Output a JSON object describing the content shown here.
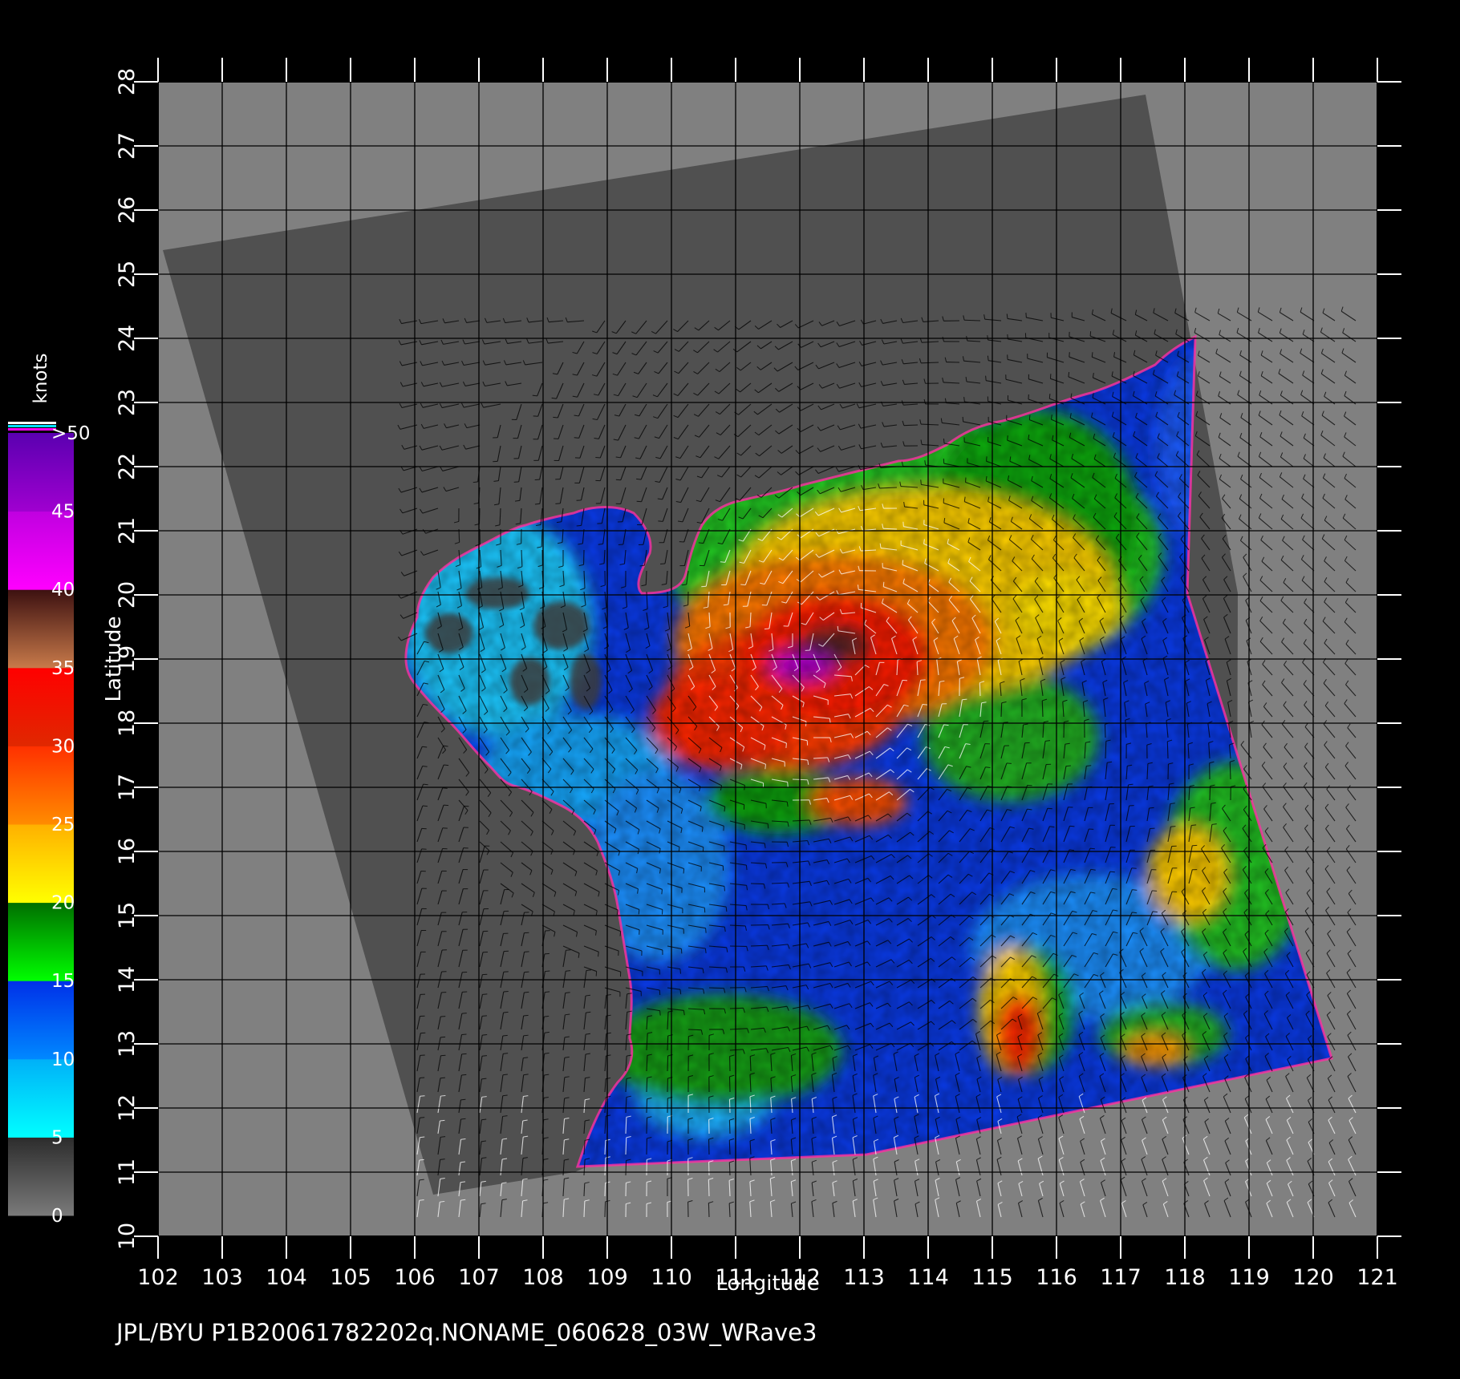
{
  "map": {
    "lon_range": [
      102,
      121
    ],
    "lat_range": [
      10,
      28
    ],
    "lon_ticks": [
      "102",
      "103",
      "104",
      "105",
      "106",
      "107",
      "108",
      "109",
      "110",
      "111",
      "112",
      "113",
      "114",
      "115",
      "116",
      "117",
      "118",
      "119",
      "120",
      "121"
    ],
    "lat_ticks": [
      "10",
      "11",
      "12",
      "13",
      "14",
      "15",
      "16",
      "17",
      "18",
      "19",
      "20",
      "21",
      "22",
      "23",
      "24",
      "25",
      "26",
      "27",
      "28"
    ],
    "xlabel": "Longitude",
    "ylabel": "Latitude",
    "grid": true,
    "storm_center": {
      "lon": 112.7,
      "lat": 19.1
    },
    "colors": {
      "background": "#000000",
      "land_and_offswath": "#808080",
      "swath_no_data": "#505050",
      "grid": "#000000"
    }
  },
  "colorbar": {
    "unit_label": "knots",
    "labels": [
      "0",
      "5",
      "10",
      "15",
      "20",
      "25",
      "30",
      "35",
      "40",
      "45",
      ">50"
    ],
    "bands": [
      {
        "range": "0-5",
        "colors": [
          "#7a7a7a",
          "#2c2c2c"
        ]
      },
      {
        "range": "5-10",
        "colors": [
          "#00ffff",
          "#00b0f8"
        ]
      },
      {
        "range": "10-15",
        "colors": [
          "#0088ff",
          "#0030e8"
        ]
      },
      {
        "range": "15-20",
        "colors": [
          "#00ff00",
          "#006e00"
        ]
      },
      {
        "range": "20-25",
        "colors": [
          "#ffff00",
          "#ffb000"
        ]
      },
      {
        "range": "25-30",
        "colors": [
          "#ff8c00",
          "#ff3000"
        ]
      },
      {
        "range": "30-35",
        "colors": [
          "#e02800",
          "#ff0000"
        ]
      },
      {
        "range": "35-40",
        "colors": [
          "#c87a4a",
          "#3c1010"
        ]
      },
      {
        "range": "40-45",
        "colors": [
          "#ff00ff",
          "#c000e0"
        ]
      },
      {
        "range": "45-50",
        "colors": [
          "#a000d0",
          "#5a00b0"
        ]
      }
    ],
    "overflow_colors": [
      "#ffffff",
      "#00e0ff",
      "#ff00ff"
    ]
  },
  "credit": "JPL/BYU  P1B20061782202q.NONAME_060628_03W_WRave3"
}
